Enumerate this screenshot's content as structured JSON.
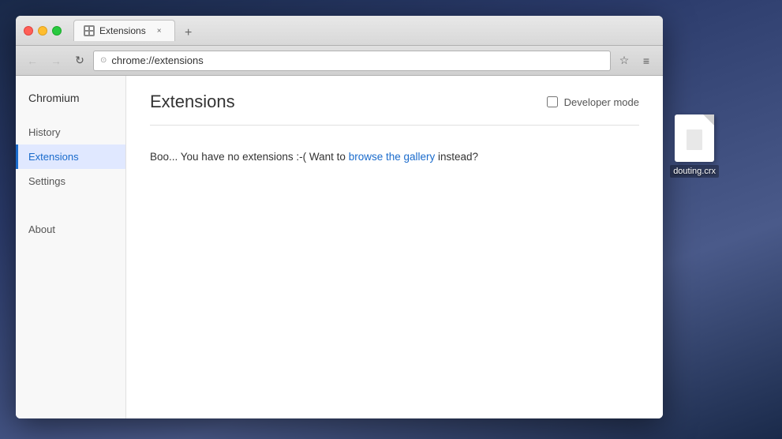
{
  "desktop": {
    "file_icon": {
      "name": "douting.crx"
    }
  },
  "browser": {
    "tab": {
      "title": "Extensions",
      "icon": "puzzle-icon"
    },
    "address_bar": {
      "url": "chrome://extensions"
    },
    "nav": {
      "back_label": "←",
      "forward_label": "→",
      "reload_label": "↻",
      "bookmark_label": "☆",
      "menu_label": "≡"
    }
  },
  "sidebar": {
    "brand": "Chromium",
    "items": [
      {
        "label": "History",
        "active": false
      },
      {
        "label": "Extensions",
        "active": true
      },
      {
        "label": "Settings",
        "active": false
      }
    ],
    "bottom_items": [
      {
        "label": "About"
      }
    ]
  },
  "main": {
    "title": "Extensions",
    "developer_mode_label": "Developer mode",
    "empty_message_prefix": "Boo... You have no extensions :-(",
    "empty_message_middle": "  Want to ",
    "browse_gallery_link": "browse the gallery",
    "empty_message_suffix": " instead?"
  }
}
